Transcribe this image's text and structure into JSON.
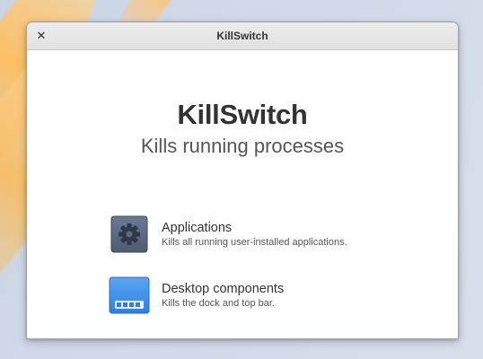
{
  "window": {
    "title": "KillSwitch",
    "close_glyph": "✕"
  },
  "main": {
    "heading": "KillSwitch",
    "subheading": "Kills running processes"
  },
  "options": [
    {
      "icon": "applications-gear-icon",
      "label": "Applications",
      "description": "Kills all running user-installed applications."
    },
    {
      "icon": "desktop-dock-icon",
      "label": "Desktop components",
      "description": "Kills the dock and top bar."
    }
  ],
  "colors": {
    "gear_icon_bg": "#5b6a82",
    "dock_icon_bg": "#3d8ee8"
  }
}
